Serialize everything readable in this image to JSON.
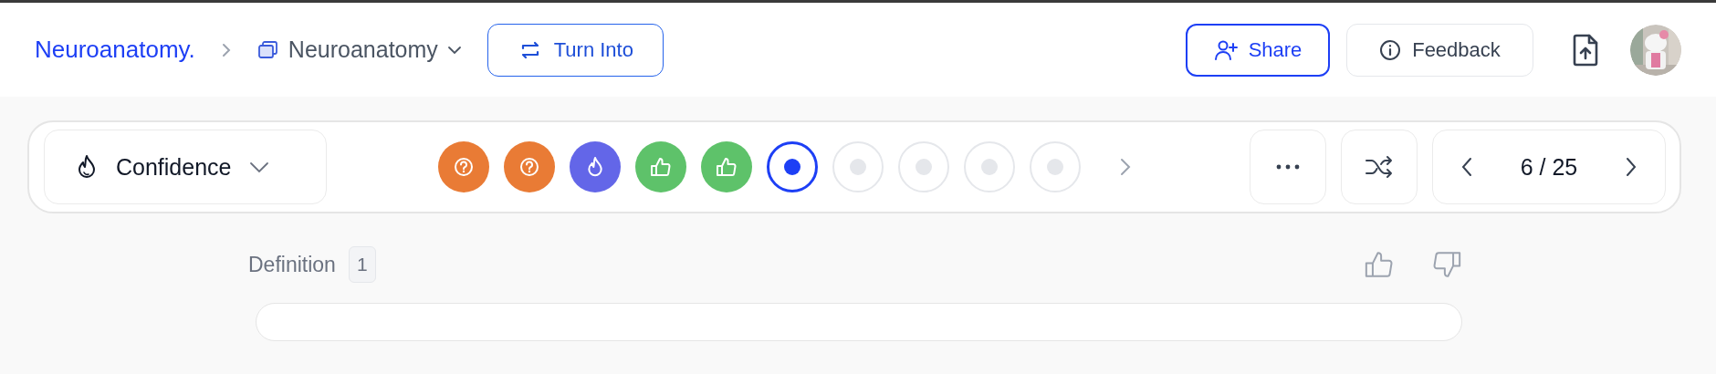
{
  "breadcrumb": {
    "root": "Neuroanatomy.",
    "current": "Neuroanatomy"
  },
  "header_buttons": {
    "turn_into": "Turn Into",
    "share": "Share",
    "feedback": "Feedback"
  },
  "toolbar": {
    "mode": "Confidence",
    "cards": [
      {
        "kind": "question",
        "color": "#e97b35"
      },
      {
        "kind": "question",
        "color": "#e97b35"
      },
      {
        "kind": "fire",
        "color": "#6366e8"
      },
      {
        "kind": "thumb",
        "color": "#5ec26a"
      },
      {
        "kind": "thumb",
        "color": "#5ec26a"
      },
      {
        "kind": "current",
        "color": "#1d3ff5"
      },
      {
        "kind": "empty"
      },
      {
        "kind": "empty"
      },
      {
        "kind": "empty"
      },
      {
        "kind": "empty"
      }
    ],
    "pager": "6 / 25"
  },
  "definition": {
    "label": "Definition",
    "count": "1"
  }
}
